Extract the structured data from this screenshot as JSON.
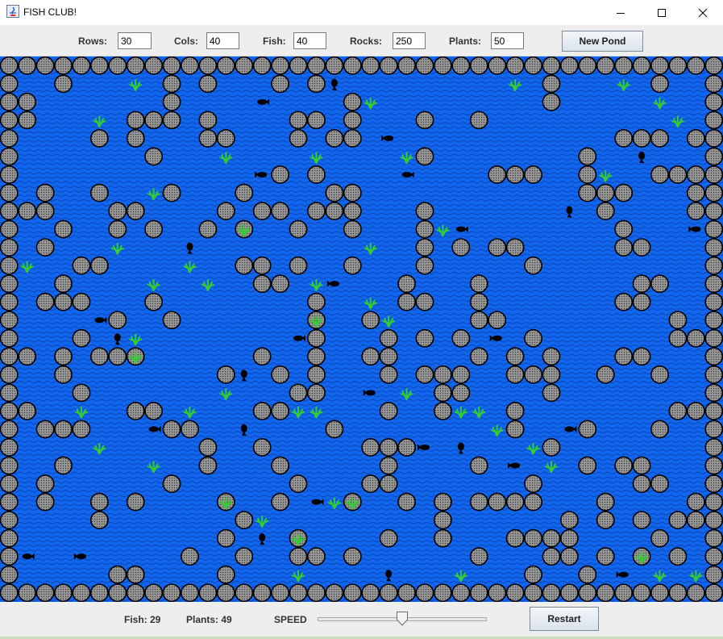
{
  "window": {
    "title": "FISH CLUB!"
  },
  "controls": {
    "rows_label": "Rows:",
    "rows_value": "30",
    "cols_label": "Cols:",
    "cols_value": "40",
    "fish_label": "Fish:",
    "fish_value": "40",
    "rocks_label": "Rocks:",
    "rocks_value": "250",
    "plants_label": "Plants:",
    "plants_value": "50",
    "new_pond_label": "New Pond"
  },
  "status": {
    "fish_count": "Fish: 29",
    "plants_count": "Plants: 49",
    "speed_label": "SPEED",
    "restart_label": "Restart"
  },
  "speed_slider": {
    "value_fraction": 0.5
  },
  "colors": {
    "water": "#1166ee",
    "water_ripple": "#0a3fb0",
    "rock_fill": "#8c8c8c",
    "rock_outline": "#000000",
    "plant": "#33cc33",
    "fish": "#000000"
  },
  "grid": {
    "rows": 30,
    "cols": 40,
    "cell_icons": [
      "rock-icon",
      "fish-icon",
      "plant-icon"
    ],
    "rocks": [
      [
        0,
        0
      ],
      [
        0,
        1
      ],
      [
        0,
        2
      ],
      [
        0,
        3
      ],
      [
        0,
        4
      ],
      [
        0,
        5
      ],
      [
        0,
        6
      ],
      [
        0,
        7
      ],
      [
        0,
        8
      ],
      [
        0,
        9
      ],
      [
        0,
        10
      ],
      [
        0,
        11
      ],
      [
        0,
        12
      ],
      [
        0,
        13
      ],
      [
        0,
        14
      ],
      [
        0,
        15
      ],
      [
        0,
        16
      ],
      [
        0,
        17
      ],
      [
        0,
        18
      ],
      [
        0,
        19
      ],
      [
        0,
        20
      ],
      [
        0,
        21
      ],
      [
        0,
        22
      ],
      [
        0,
        23
      ],
      [
        0,
        24
      ],
      [
        0,
        25
      ],
      [
        0,
        26
      ],
      [
        0,
        27
      ],
      [
        0,
        28
      ],
      [
        0,
        29
      ],
      [
        0,
        30
      ],
      [
        0,
        31
      ],
      [
        0,
        32
      ],
      [
        0,
        33
      ],
      [
        0,
        34
      ],
      [
        0,
        35
      ],
      [
        0,
        36
      ],
      [
        0,
        37
      ],
      [
        0,
        38
      ],
      [
        0,
        39
      ],
      [
        29,
        0
      ],
      [
        29,
        1
      ],
      [
        29,
        2
      ],
      [
        29,
        3
      ],
      [
        29,
        4
      ],
      [
        29,
        5
      ],
      [
        29,
        6
      ],
      [
        29,
        7
      ],
      [
        29,
        8
      ],
      [
        29,
        9
      ],
      [
        29,
        10
      ],
      [
        29,
        11
      ],
      [
        29,
        12
      ],
      [
        29,
        13
      ],
      [
        29,
        14
      ],
      [
        29,
        15
      ],
      [
        29,
        16
      ],
      [
        29,
        17
      ],
      [
        29,
        18
      ],
      [
        29,
        19
      ],
      [
        29,
        20
      ],
      [
        29,
        21
      ],
      [
        29,
        22
      ],
      [
        29,
        23
      ],
      [
        29,
        24
      ],
      [
        29,
        25
      ],
      [
        29,
        26
      ],
      [
        29,
        27
      ],
      [
        29,
        28
      ],
      [
        29,
        29
      ],
      [
        29,
        30
      ],
      [
        29,
        31
      ],
      [
        29,
        32
      ],
      [
        29,
        33
      ],
      [
        29,
        34
      ],
      [
        29,
        35
      ],
      [
        29,
        36
      ],
      [
        29,
        37
      ],
      [
        29,
        38
      ],
      [
        29,
        39
      ],
      [
        1,
        0
      ],
      [
        2,
        0
      ],
      [
        3,
        0
      ],
      [
        4,
        0
      ],
      [
        5,
        0
      ],
      [
        6,
        0
      ],
      [
        7,
        0
      ],
      [
        8,
        0
      ],
      [
        9,
        0
      ],
      [
        10,
        0
      ],
      [
        11,
        0
      ],
      [
        12,
        0
      ],
      [
        13,
        0
      ],
      [
        14,
        0
      ],
      [
        15,
        0
      ],
      [
        16,
        0
      ],
      [
        17,
        0
      ],
      [
        18,
        0
      ],
      [
        19,
        0
      ],
      [
        20,
        0
      ],
      [
        21,
        0
      ],
      [
        22,
        0
      ],
      [
        23,
        0
      ],
      [
        24,
        0
      ],
      [
        25,
        0
      ],
      [
        26,
        0
      ],
      [
        27,
        0
      ],
      [
        28,
        0
      ],
      [
        1,
        39
      ],
      [
        2,
        39
      ],
      [
        3,
        39
      ],
      [
        4,
        39
      ],
      [
        5,
        39
      ],
      [
        6,
        39
      ],
      [
        7,
        39
      ],
      [
        8,
        39
      ],
      [
        9,
        39
      ],
      [
        10,
        39
      ],
      [
        11,
        39
      ],
      [
        12,
        39
      ],
      [
        13,
        39
      ],
      [
        14,
        39
      ],
      [
        15,
        39
      ],
      [
        16,
        39
      ],
      [
        17,
        39
      ],
      [
        18,
        39
      ],
      [
        19,
        39
      ],
      [
        20,
        39
      ],
      [
        21,
        39
      ],
      [
        22,
        39
      ],
      [
        23,
        39
      ],
      [
        24,
        39
      ],
      [
        25,
        39
      ],
      [
        26,
        39
      ],
      [
        27,
        39
      ],
      [
        28,
        39
      ],
      [
        1,
        3
      ],
      [
        1,
        9
      ],
      [
        1,
        11
      ],
      [
        1,
        15
      ],
      [
        1,
        17
      ],
      [
        1,
        30
      ],
      [
        1,
        36
      ],
      [
        2,
        1
      ],
      [
        2,
        9
      ],
      [
        2,
        19
      ],
      [
        2,
        30
      ],
      [
        3,
        1
      ],
      [
        3,
        7
      ],
      [
        3,
        8
      ],
      [
        3,
        9
      ],
      [
        3,
        11
      ],
      [
        3,
        16
      ],
      [
        3,
        17
      ],
      [
        3,
        19
      ],
      [
        3,
        23
      ],
      [
        3,
        26
      ],
      [
        4,
        5
      ],
      [
        4,
        7
      ],
      [
        4,
        11
      ],
      [
        4,
        12
      ],
      [
        4,
        16
      ],
      [
        4,
        18
      ],
      [
        4,
        19
      ],
      [
        4,
        34
      ],
      [
        4,
        35
      ],
      [
        4,
        36
      ],
      [
        4,
        38
      ],
      [
        5,
        8
      ],
      [
        5,
        23
      ],
      [
        5,
        32
      ],
      [
        6,
        15
      ],
      [
        6,
        17
      ],
      [
        6,
        27
      ],
      [
        6,
        28
      ],
      [
        6,
        29
      ],
      [
        6,
        32
      ],
      [
        6,
        36
      ],
      [
        6,
        37
      ],
      [
        6,
        38
      ],
      [
        7,
        2
      ],
      [
        7,
        5
      ],
      [
        7,
        9
      ],
      [
        7,
        13
      ],
      [
        7,
        18
      ],
      [
        7,
        19
      ],
      [
        7,
        32
      ],
      [
        7,
        33
      ],
      [
        7,
        34
      ],
      [
        7,
        38
      ],
      [
        8,
        1
      ],
      [
        8,
        2
      ],
      [
        8,
        6
      ],
      [
        8,
        7
      ],
      [
        8,
        12
      ],
      [
        8,
        14
      ],
      [
        8,
        15
      ],
      [
        8,
        17
      ],
      [
        8,
        18
      ],
      [
        8,
        19
      ],
      [
        8,
        23
      ],
      [
        8,
        33
      ],
      [
        8,
        38
      ],
      [
        9,
        3
      ],
      [
        9,
        6
      ],
      [
        9,
        8
      ],
      [
        9,
        11
      ],
      [
        9,
        13
      ],
      [
        9,
        16
      ],
      [
        9,
        19
      ],
      [
        9,
        23
      ],
      [
        9,
        34
      ],
      [
        10,
        2
      ],
      [
        10,
        23
      ],
      [
        10,
        25
      ],
      [
        10,
        27
      ],
      [
        10,
        28
      ],
      [
        10,
        34
      ],
      [
        10,
        35
      ],
      [
        11,
        4
      ],
      [
        11,
        5
      ],
      [
        11,
        13
      ],
      [
        11,
        14
      ],
      [
        11,
        16
      ],
      [
        11,
        19
      ],
      [
        11,
        23
      ],
      [
        11,
        29
      ],
      [
        12,
        3
      ],
      [
        12,
        14
      ],
      [
        12,
        15
      ],
      [
        12,
        22
      ],
      [
        12,
        26
      ],
      [
        12,
        35
      ],
      [
        12,
        36
      ],
      [
        13,
        2
      ],
      [
        13,
        3
      ],
      [
        13,
        4
      ],
      [
        13,
        8
      ],
      [
        13,
        17
      ],
      [
        13,
        22
      ],
      [
        13,
        23
      ],
      [
        13,
        26
      ],
      [
        13,
        34
      ],
      [
        13,
        35
      ],
      [
        14,
        6
      ],
      [
        14,
        9
      ],
      [
        14,
        17
      ],
      [
        14,
        20
      ],
      [
        14,
        26
      ],
      [
        14,
        27
      ],
      [
        14,
        37
      ],
      [
        15,
        4
      ],
      [
        15,
        17
      ],
      [
        15,
        21
      ],
      [
        15,
        23
      ],
      [
        15,
        25
      ],
      [
        15,
        29
      ],
      [
        15,
        37
      ],
      [
        15,
        38
      ],
      [
        16,
        1
      ],
      [
        16,
        3
      ],
      [
        16,
        5
      ],
      [
        16,
        6
      ],
      [
        16,
        7
      ],
      [
        16,
        14
      ],
      [
        16,
        17
      ],
      [
        16,
        20
      ],
      [
        16,
        21
      ],
      [
        16,
        26
      ],
      [
        16,
        28
      ],
      [
        16,
        30
      ],
      [
        16,
        34
      ],
      [
        16,
        35
      ],
      [
        17,
        3
      ],
      [
        17,
        12
      ],
      [
        17,
        15
      ],
      [
        17,
        17
      ],
      [
        17,
        21
      ],
      [
        17,
        23
      ],
      [
        17,
        24
      ],
      [
        17,
        25
      ],
      [
        17,
        28
      ],
      [
        17,
        29
      ],
      [
        17,
        30
      ],
      [
        17,
        33
      ],
      [
        17,
        36
      ],
      [
        18,
        4
      ],
      [
        18,
        16
      ],
      [
        18,
        17
      ],
      [
        18,
        24
      ],
      [
        18,
        25
      ],
      [
        18,
        30
      ],
      [
        19,
        1
      ],
      [
        19,
        7
      ],
      [
        19,
        8
      ],
      [
        19,
        14
      ],
      [
        19,
        15
      ],
      [
        19,
        21
      ],
      [
        19,
        24
      ],
      [
        19,
        28
      ],
      [
        19,
        37
      ],
      [
        19,
        38
      ],
      [
        20,
        2
      ],
      [
        20,
        3
      ],
      [
        20,
        4
      ],
      [
        20,
        9
      ],
      [
        20,
        10
      ],
      [
        20,
        18
      ],
      [
        20,
        28
      ],
      [
        20,
        32
      ],
      [
        20,
        36
      ],
      [
        21,
        11
      ],
      [
        21,
        14
      ],
      [
        21,
        20
      ],
      [
        21,
        21
      ],
      [
        21,
        22
      ],
      [
        21,
        30
      ],
      [
        22,
        3
      ],
      [
        22,
        11
      ],
      [
        22,
        15
      ],
      [
        22,
        21
      ],
      [
        22,
        26
      ],
      [
        22,
        32
      ],
      [
        22,
        34
      ],
      [
        22,
        35
      ],
      [
        23,
        2
      ],
      [
        23,
        9
      ],
      [
        23,
        16
      ],
      [
        23,
        20
      ],
      [
        23,
        21
      ],
      [
        23,
        29
      ],
      [
        23,
        35
      ],
      [
        23,
        36
      ],
      [
        24,
        2
      ],
      [
        24,
        5
      ],
      [
        24,
        7
      ],
      [
        24,
        12
      ],
      [
        24,
        15
      ],
      [
        24,
        19
      ],
      [
        24,
        22
      ],
      [
        24,
        24
      ],
      [
        24,
        26
      ],
      [
        24,
        27
      ],
      [
        24,
        28
      ],
      [
        24,
        29
      ],
      [
        24,
        33
      ],
      [
        24,
        38
      ],
      [
        25,
        5
      ],
      [
        25,
        13
      ],
      [
        25,
        24
      ],
      [
        25,
        31
      ],
      [
        25,
        33
      ],
      [
        25,
        35
      ],
      [
        25,
        37
      ],
      [
        25,
        38
      ],
      [
        26,
        12
      ],
      [
        26,
        16
      ],
      [
        26,
        21
      ],
      [
        26,
        24
      ],
      [
        26,
        28
      ],
      [
        26,
        29
      ],
      [
        26,
        30
      ],
      [
        26,
        31
      ],
      [
        26,
        36
      ],
      [
        27,
        10
      ],
      [
        27,
        13
      ],
      [
        27,
        16
      ],
      [
        27,
        17
      ],
      [
        27,
        19
      ],
      [
        27,
        26
      ],
      [
        27,
        30
      ],
      [
        27,
        31
      ],
      [
        27,
        33
      ],
      [
        27,
        35
      ],
      [
        27,
        37
      ],
      [
        28,
        6
      ],
      [
        28,
        7
      ],
      [
        28,
        12
      ],
      [
        28,
        29
      ],
      [
        28,
        32
      ]
    ],
    "plants": [
      [
        1,
        7
      ],
      [
        1,
        28
      ],
      [
        1,
        34
      ],
      [
        2,
        20
      ],
      [
        2,
        36
      ],
      [
        3,
        5
      ],
      [
        3,
        37
      ],
      [
        5,
        12
      ],
      [
        5,
        17
      ],
      [
        5,
        22
      ],
      [
        6,
        33
      ],
      [
        7,
        8
      ],
      [
        9,
        13
      ],
      [
        9,
        24
      ],
      [
        10,
        6
      ],
      [
        10,
        20
      ],
      [
        11,
        1
      ],
      [
        11,
        10
      ],
      [
        12,
        8
      ],
      [
        12,
        11
      ],
      [
        12,
        17
      ],
      [
        13,
        20
      ],
      [
        14,
        17
      ],
      [
        14,
        21
      ],
      [
        15,
        7
      ],
      [
        16,
        7
      ],
      [
        18,
        12
      ],
      [
        18,
        22
      ],
      [
        19,
        4
      ],
      [
        19,
        10
      ],
      [
        19,
        16
      ],
      [
        19,
        17
      ],
      [
        19,
        25
      ],
      [
        19,
        26
      ],
      [
        20,
        27
      ],
      [
        21,
        5
      ],
      [
        21,
        29
      ],
      [
        22,
        8
      ],
      [
        22,
        30
      ],
      [
        24,
        12
      ],
      [
        24,
        18
      ],
      [
        24,
        19
      ],
      [
        25,
        14
      ],
      [
        26,
        16
      ],
      [
        27,
        35
      ],
      [
        28,
        16
      ],
      [
        28,
        25
      ],
      [
        28,
        36
      ],
      [
        28,
        38
      ]
    ],
    "fish": [
      [
        1,
        18
      ],
      [
        2,
        14
      ],
      [
        4,
        21
      ],
      [
        5,
        35
      ],
      [
        6,
        14
      ],
      [
        6,
        22
      ],
      [
        8,
        31
      ],
      [
        9,
        25
      ],
      [
        9,
        38
      ],
      [
        10,
        10
      ],
      [
        12,
        18
      ],
      [
        14,
        5
      ],
      [
        15,
        6
      ],
      [
        15,
        16
      ],
      [
        15,
        27
      ],
      [
        17,
        13
      ],
      [
        18,
        20
      ],
      [
        20,
        8
      ],
      [
        20,
        13
      ],
      [
        20,
        31
      ],
      [
        21,
        23
      ],
      [
        21,
        25
      ],
      [
        22,
        28
      ],
      [
        24,
        17
      ],
      [
        26,
        14
      ],
      [
        27,
        1
      ],
      [
        27,
        4
      ],
      [
        28,
        21
      ],
      [
        28,
        34
      ]
    ]
  }
}
